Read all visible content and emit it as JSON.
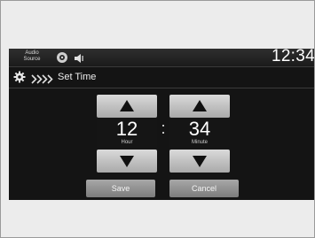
{
  "statusbar": {
    "audio_source_line1": "Audio",
    "audio_source_line2": "Source",
    "clock": "12:34"
  },
  "title": {
    "text": "Set Time"
  },
  "time": {
    "hour": "12",
    "hour_label": "Hour",
    "minute": "34",
    "minute_label": "Minute",
    "separator": ":"
  },
  "buttons": {
    "save": "Save",
    "cancel": "Cancel"
  },
  "icons": {
    "status": [
      "disc-icon",
      "speaker-icon"
    ],
    "title": [
      "gear-icon",
      "breadcrumb-chevrons-icon"
    ],
    "controls": [
      "arrow-up-icon",
      "arrow-down-icon"
    ]
  },
  "colors": {
    "screen_background": "#141414",
    "button_gray": "#9a9a9a",
    "text": "#ffffff"
  }
}
